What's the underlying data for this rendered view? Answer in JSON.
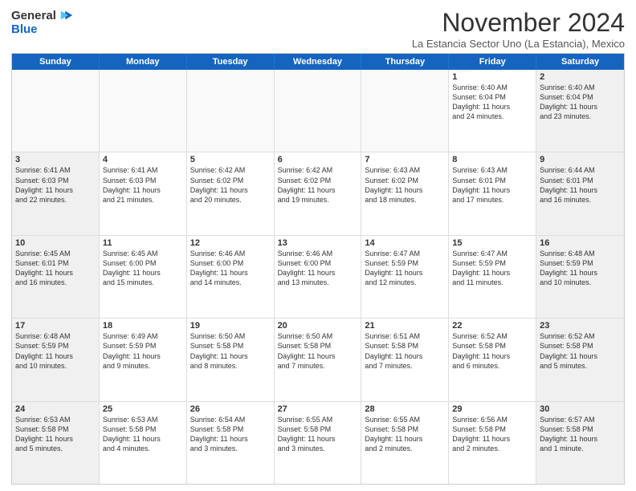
{
  "logo": {
    "general": "General",
    "blue": "Blue"
  },
  "title": "November 2024",
  "location": "La Estancia Sector Uno (La Estancia), Mexico",
  "header_days": [
    "Sunday",
    "Monday",
    "Tuesday",
    "Wednesday",
    "Thursday",
    "Friday",
    "Saturday"
  ],
  "weeks": [
    [
      {
        "day": "",
        "lines": [],
        "empty": true
      },
      {
        "day": "",
        "lines": [],
        "empty": true
      },
      {
        "day": "",
        "lines": [],
        "empty": true
      },
      {
        "day": "",
        "lines": [],
        "empty": true
      },
      {
        "day": "",
        "lines": [],
        "empty": true
      },
      {
        "day": "1",
        "lines": [
          "Sunrise: 6:40 AM",
          "Sunset: 6:04 PM",
          "Daylight: 11 hours",
          "and 24 minutes."
        ]
      },
      {
        "day": "2",
        "lines": [
          "Sunrise: 6:40 AM",
          "Sunset: 6:04 PM",
          "Daylight: 11 hours",
          "and 23 minutes."
        ],
        "shaded": true
      }
    ],
    [
      {
        "day": "3",
        "lines": [
          "Sunrise: 6:41 AM",
          "Sunset: 6:03 PM",
          "Daylight: 11 hours",
          "and 22 minutes."
        ],
        "shaded": true
      },
      {
        "day": "4",
        "lines": [
          "Sunrise: 6:41 AM",
          "Sunset: 6:03 PM",
          "Daylight: 11 hours",
          "and 21 minutes."
        ]
      },
      {
        "day": "5",
        "lines": [
          "Sunrise: 6:42 AM",
          "Sunset: 6:02 PM",
          "Daylight: 11 hours",
          "and 20 minutes."
        ]
      },
      {
        "day": "6",
        "lines": [
          "Sunrise: 6:42 AM",
          "Sunset: 6:02 PM",
          "Daylight: 11 hours",
          "and 19 minutes."
        ]
      },
      {
        "day": "7",
        "lines": [
          "Sunrise: 6:43 AM",
          "Sunset: 6:02 PM",
          "Daylight: 11 hours",
          "and 18 minutes."
        ]
      },
      {
        "day": "8",
        "lines": [
          "Sunrise: 6:43 AM",
          "Sunset: 6:01 PM",
          "Daylight: 11 hours",
          "and 17 minutes."
        ]
      },
      {
        "day": "9",
        "lines": [
          "Sunrise: 6:44 AM",
          "Sunset: 6:01 PM",
          "Daylight: 11 hours",
          "and 16 minutes."
        ],
        "shaded": true
      }
    ],
    [
      {
        "day": "10",
        "lines": [
          "Sunrise: 6:45 AM",
          "Sunset: 6:01 PM",
          "Daylight: 11 hours",
          "and 16 minutes."
        ],
        "shaded": true
      },
      {
        "day": "11",
        "lines": [
          "Sunrise: 6:45 AM",
          "Sunset: 6:00 PM",
          "Daylight: 11 hours",
          "and 15 minutes."
        ]
      },
      {
        "day": "12",
        "lines": [
          "Sunrise: 6:46 AM",
          "Sunset: 6:00 PM",
          "Daylight: 11 hours",
          "and 14 minutes."
        ]
      },
      {
        "day": "13",
        "lines": [
          "Sunrise: 6:46 AM",
          "Sunset: 6:00 PM",
          "Daylight: 11 hours",
          "and 13 minutes."
        ]
      },
      {
        "day": "14",
        "lines": [
          "Sunrise: 6:47 AM",
          "Sunset: 5:59 PM",
          "Daylight: 11 hours",
          "and 12 minutes."
        ]
      },
      {
        "day": "15",
        "lines": [
          "Sunrise: 6:47 AM",
          "Sunset: 5:59 PM",
          "Daylight: 11 hours",
          "and 11 minutes."
        ]
      },
      {
        "day": "16",
        "lines": [
          "Sunrise: 6:48 AM",
          "Sunset: 5:59 PM",
          "Daylight: 11 hours",
          "and 10 minutes."
        ],
        "shaded": true
      }
    ],
    [
      {
        "day": "17",
        "lines": [
          "Sunrise: 6:48 AM",
          "Sunset: 5:59 PM",
          "Daylight: 11 hours",
          "and 10 minutes."
        ],
        "shaded": true
      },
      {
        "day": "18",
        "lines": [
          "Sunrise: 6:49 AM",
          "Sunset: 5:59 PM",
          "Daylight: 11 hours",
          "and 9 minutes."
        ]
      },
      {
        "day": "19",
        "lines": [
          "Sunrise: 6:50 AM",
          "Sunset: 5:58 PM",
          "Daylight: 11 hours",
          "and 8 minutes."
        ]
      },
      {
        "day": "20",
        "lines": [
          "Sunrise: 6:50 AM",
          "Sunset: 5:58 PM",
          "Daylight: 11 hours",
          "and 7 minutes."
        ]
      },
      {
        "day": "21",
        "lines": [
          "Sunrise: 6:51 AM",
          "Sunset: 5:58 PM",
          "Daylight: 11 hours",
          "and 7 minutes."
        ]
      },
      {
        "day": "22",
        "lines": [
          "Sunrise: 6:52 AM",
          "Sunset: 5:58 PM",
          "Daylight: 11 hours",
          "and 6 minutes."
        ]
      },
      {
        "day": "23",
        "lines": [
          "Sunrise: 6:52 AM",
          "Sunset: 5:58 PM",
          "Daylight: 11 hours",
          "and 5 minutes."
        ],
        "shaded": true
      }
    ],
    [
      {
        "day": "24",
        "lines": [
          "Sunrise: 6:53 AM",
          "Sunset: 5:58 PM",
          "Daylight: 11 hours",
          "and 5 minutes."
        ],
        "shaded": true
      },
      {
        "day": "25",
        "lines": [
          "Sunrise: 6:53 AM",
          "Sunset: 5:58 PM",
          "Daylight: 11 hours",
          "and 4 minutes."
        ]
      },
      {
        "day": "26",
        "lines": [
          "Sunrise: 6:54 AM",
          "Sunset: 5:58 PM",
          "Daylight: 11 hours",
          "and 3 minutes."
        ]
      },
      {
        "day": "27",
        "lines": [
          "Sunrise: 6:55 AM",
          "Sunset: 5:58 PM",
          "Daylight: 11 hours",
          "and 3 minutes."
        ]
      },
      {
        "day": "28",
        "lines": [
          "Sunrise: 6:55 AM",
          "Sunset: 5:58 PM",
          "Daylight: 11 hours",
          "and 2 minutes."
        ]
      },
      {
        "day": "29",
        "lines": [
          "Sunrise: 6:56 AM",
          "Sunset: 5:58 PM",
          "Daylight: 11 hours",
          "and 2 minutes."
        ]
      },
      {
        "day": "30",
        "lines": [
          "Sunrise: 6:57 AM",
          "Sunset: 5:58 PM",
          "Daylight: 11 hours",
          "and 1 minute."
        ],
        "shaded": true
      }
    ]
  ]
}
